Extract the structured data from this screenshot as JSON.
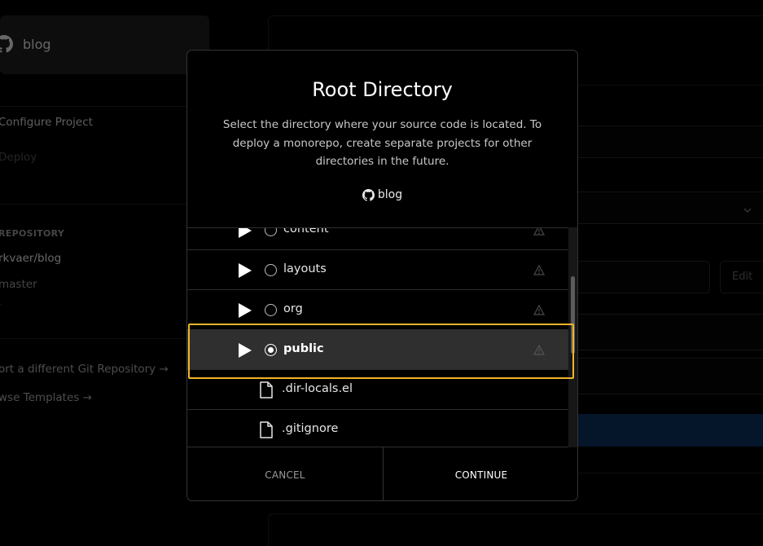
{
  "background": {
    "repo_name": "blog",
    "steps": {
      "configure": "Configure Project",
      "deploy": "Deploy"
    },
    "repository_label": "REPOSITORY",
    "repository_name": "rkvaer/blog",
    "branch": "master",
    "root_marker": "/",
    "links": {
      "import_different": "ort a different Git Repository →",
      "browse_templates": "wse Templates →"
    },
    "edit_label": "Edit"
  },
  "modal": {
    "title": "Root Directory",
    "description": "Select the directory where your source code is located. To deploy a monorepo, create separate projects for other directories in the future.",
    "repo": "blog",
    "folders": [
      {
        "label": "content",
        "selected": false
      },
      {
        "label": "layouts",
        "selected": false
      },
      {
        "label": "org",
        "selected": false
      },
      {
        "label": "public",
        "selected": true
      }
    ],
    "files": [
      {
        "label": ".dir-locals.el"
      },
      {
        "label": ".gitignore"
      }
    ],
    "cancel_label": "CANCEL",
    "continue_label": "CONTINUE"
  },
  "colors": {
    "highlight": "#f0b429",
    "deploy_button": "#0b2a55",
    "selected_row": "#2f2f2f"
  }
}
